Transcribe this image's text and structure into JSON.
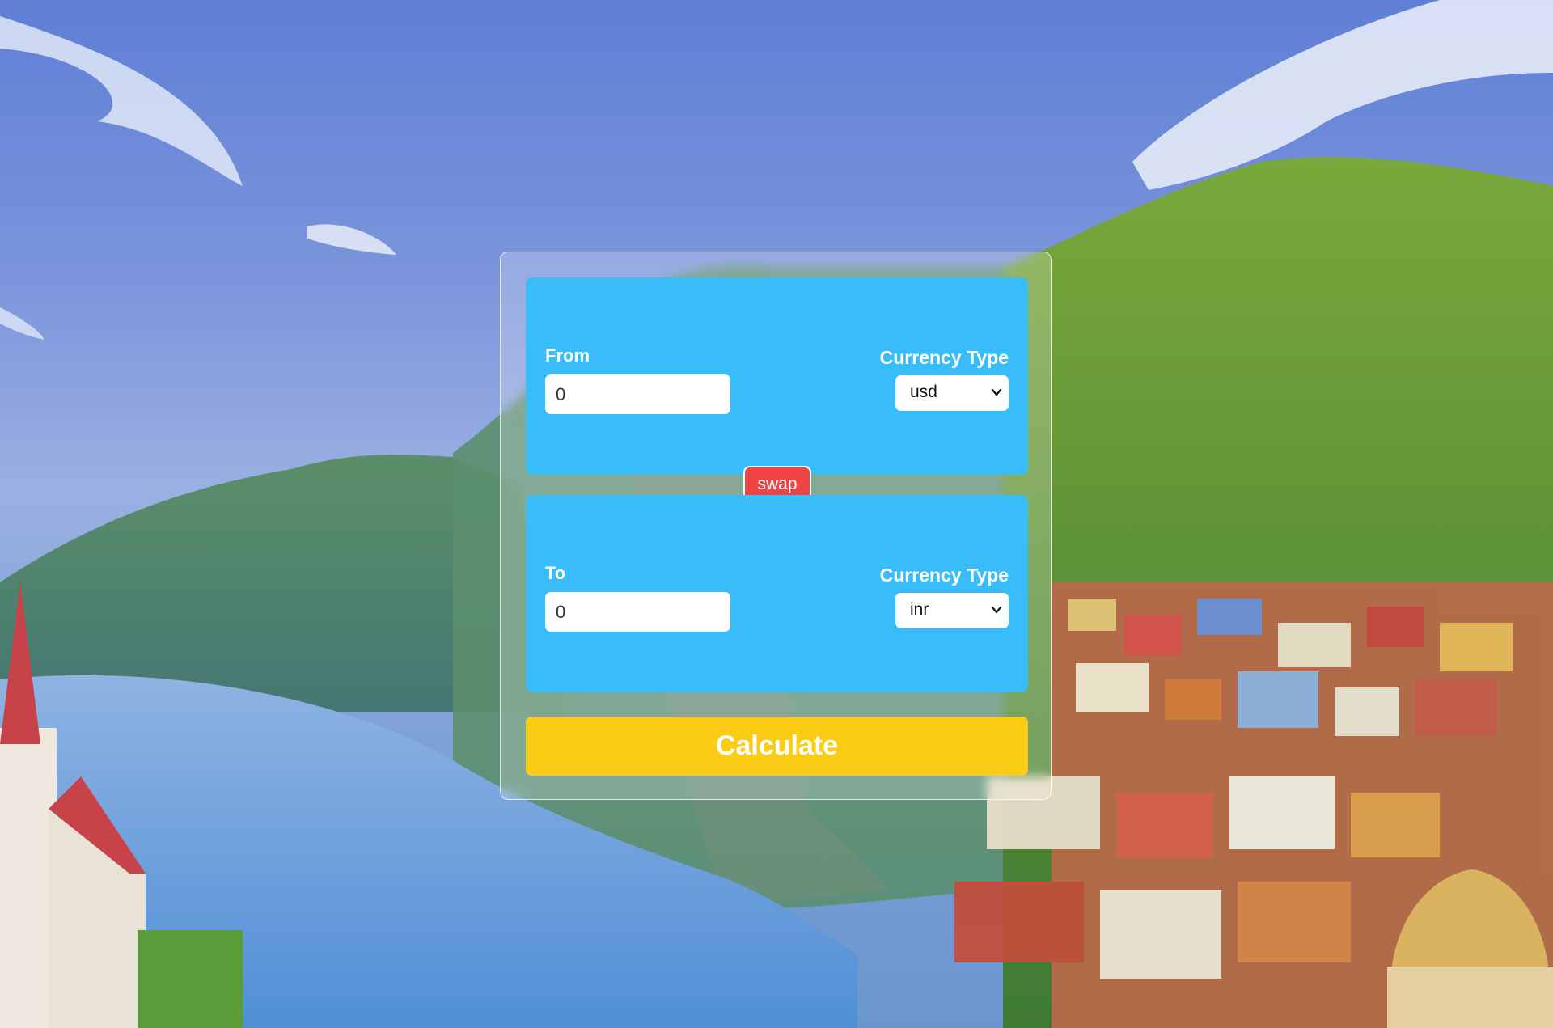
{
  "background": {
    "description_icon": "landscape-illustration"
  },
  "converter": {
    "from": {
      "label": "From",
      "amount": "0",
      "currency_label": "Currency Type",
      "currency_value": "usd"
    },
    "swap_label": "swap",
    "to": {
      "label": "To",
      "amount": "0",
      "currency_label": "Currency Type",
      "currency_value": "inr"
    },
    "calculate_label": "Calculate"
  },
  "colors": {
    "panel": "#38bdf8",
    "swap": "#ef4444",
    "calculate": "#facc15"
  }
}
